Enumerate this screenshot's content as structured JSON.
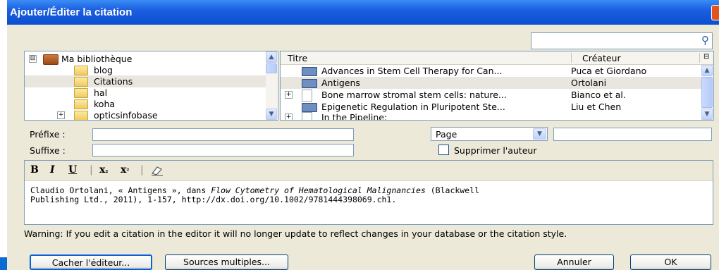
{
  "window": {
    "title": "Ajouter/Éditer la citation"
  },
  "search": {
    "value": "",
    "icon": "search-icon"
  },
  "library_tree": {
    "items": [
      {
        "label": "Ma bibliothèque",
        "expander": "⊟",
        "icon": "library-icon"
      },
      {
        "label": "blog",
        "icon": "folder-icon"
      },
      {
        "label": "Citations",
        "icon": "folder-icon",
        "selected": true
      },
      {
        "label": "hal",
        "icon": "folder-icon"
      },
      {
        "label": "koha",
        "icon": "folder-icon"
      },
      {
        "label": "opticsinfobase",
        "expander": "+",
        "icon": "folder-icon"
      }
    ]
  },
  "items_table": {
    "headers": {
      "title": "Titre",
      "creator": "Créateur",
      "picker": "⊟"
    },
    "rows": [
      {
        "title": "Advances in Stem Cell Therapy for Can...",
        "creator": "Puca et Giordano",
        "icon": "book-icon"
      },
      {
        "title": "Antigens",
        "creator": "Ortolani",
        "icon": "book-icon",
        "selected": true
      },
      {
        "title": "Bone marrow stromal stem cells: nature...",
        "creator": "Bianco et al.",
        "icon": "document-icon",
        "expander": "+"
      },
      {
        "title": "Epigenetic Regulation in Pluripotent Ste...",
        "creator": "Liu et Chen",
        "icon": "book-icon"
      },
      {
        "title": "In the Pipeline:",
        "creator": "",
        "icon": "document-icon",
        "expander": "+"
      }
    ]
  },
  "form": {
    "prefix_label": "Préfixe :",
    "prefix_value": "",
    "suffix_label": "Suffixe :",
    "suffix_value": "",
    "locator_selected": "Page",
    "locator_value": "",
    "suppress_author_label": "Supprimer l'auteur"
  },
  "editor": {
    "toolbar": {
      "bold": "B",
      "italic": "I",
      "underline": "U",
      "subscript": "x",
      "sub_mark": "₂",
      "superscript": "x",
      "sup_mark": "²",
      "separator": "|"
    },
    "citation_pre": "Claudio Ortolani, « Antigens », dans ",
    "citation_italic": "Flow Cytometry of Hematological Malignancies",
    "citation_post": " (Blackwell\nPublishing Ltd., 2011), 1‑157, http://dx.doi.org/10.1002/9781444398069.ch1."
  },
  "warning": "Warning: If you edit a citation in the editor it will no longer update to reflect changes in your database or the citation style.",
  "buttons": {
    "hide_editor": "Cacher l'éditeur...",
    "multiple_sources": "Sources multiples...",
    "cancel": "Annuler",
    "ok": "OK"
  }
}
